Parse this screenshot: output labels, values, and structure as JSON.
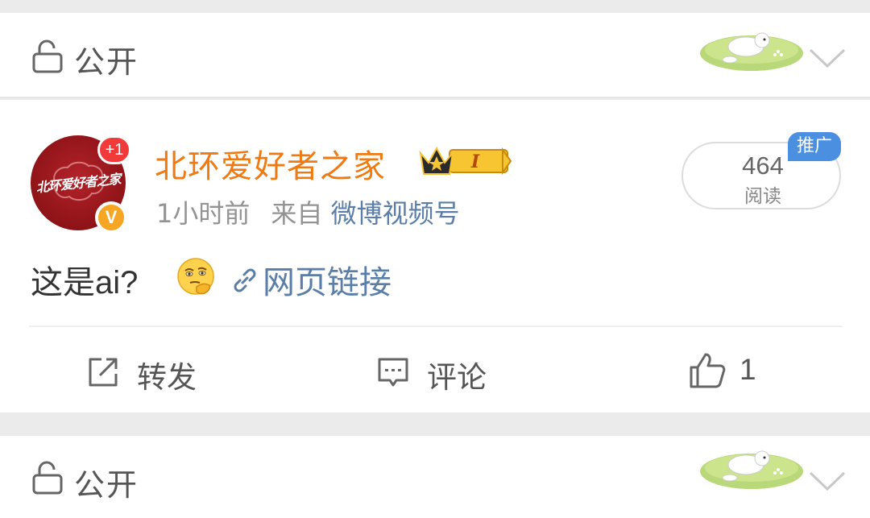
{
  "privacy_bars": [
    {
      "label": "公开",
      "icon": "lock-open-icon",
      "sticker": "sheep-on-grass-sticker",
      "chevron": "chevron-down-icon"
    },
    {
      "label": "公开",
      "icon": "lock-open-icon",
      "sticker": "sheep-on-grass-sticker",
      "chevron": "chevron-down-icon"
    }
  ],
  "post": {
    "avatar": {
      "text": "北环爱好者之家",
      "notification_badge": "+1",
      "verified_badge": "V"
    },
    "username": "北环爱好者之家",
    "member_badge_text": "I",
    "time": "1小时前",
    "source_prefix": "来自",
    "source": "微博视频号",
    "views": {
      "count": "464",
      "label": "阅读"
    },
    "promo_tag": "推广",
    "text": "这是ai?",
    "emoji": "thinking-face-emoji",
    "link_text": "网页链接",
    "actions": {
      "repost": "转发",
      "comment": "评论",
      "like": "1"
    }
  },
  "colors": {
    "username": "#f07a12",
    "link": "#5a7ea8",
    "promo": "#4a8fe0",
    "avatar_bg": "#8e1317",
    "notification": "#f23a3a",
    "verified": "#f6a623"
  }
}
